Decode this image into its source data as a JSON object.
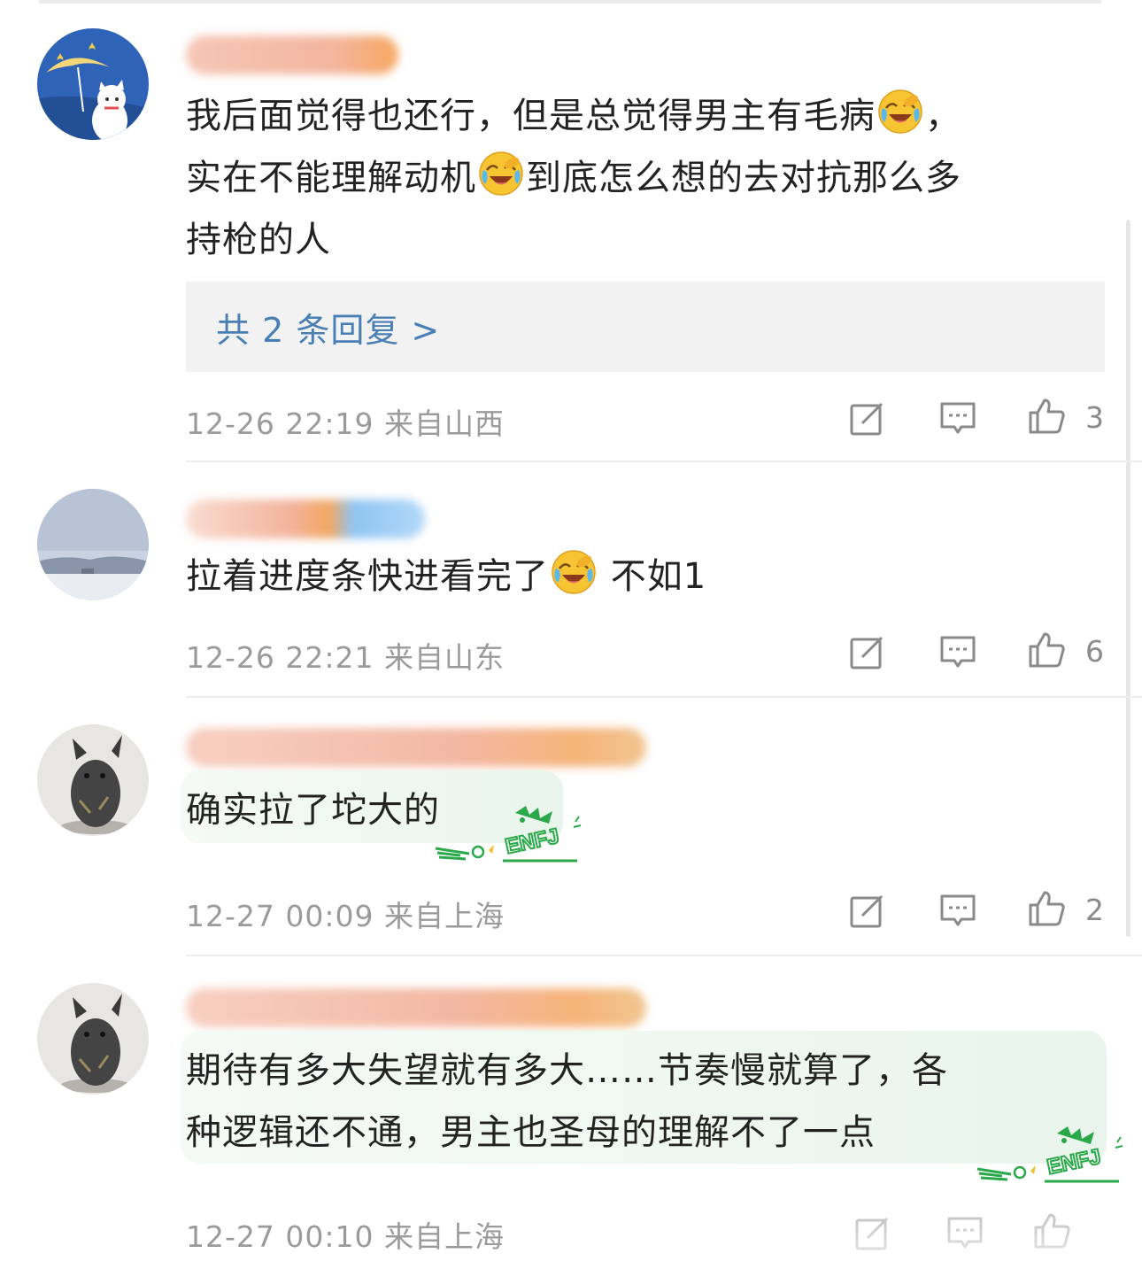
{
  "comments": [
    {
      "text_a": "我后面觉得也还行，但是总觉得男主有毛病",
      "text_b": "，",
      "text_c": "实在不能理解动机",
      "text_d": "到底怎么想的去对抗那么多",
      "text_e": "持枪的人",
      "replies_label": "共 2 条回复 >",
      "time": "12-26 22:19",
      "location": "来自山西",
      "likes": "3"
    },
    {
      "text_a": "拉着进度条快进看完了",
      "text_b": " 不如1",
      "time": "12-26 22:21",
      "location": "来自山东",
      "likes": "6"
    },
    {
      "text_a": "确实拉了坨大的",
      "badge": "ENFJ",
      "time": "12-27 00:09",
      "location": "来自上海",
      "likes": "2"
    },
    {
      "text_a": "期待有多大失望就有多大……节奏慢就算了，各",
      "text_b": "种逻辑还不通，男主也圣母的理解不了一点",
      "badge": "ENFJ",
      "time": "12-27 00:10",
      "location": "来自上海"
    }
  ],
  "icons": {
    "emoji": "laughing-crying-emoji",
    "share": "share-icon",
    "comment": "comment-icon",
    "like": "thumbs-up-icon"
  },
  "colors": {
    "link": "#4a7fb5",
    "meta": "#9a9a9a",
    "text": "#222222",
    "badge": "#2aa84a"
  }
}
